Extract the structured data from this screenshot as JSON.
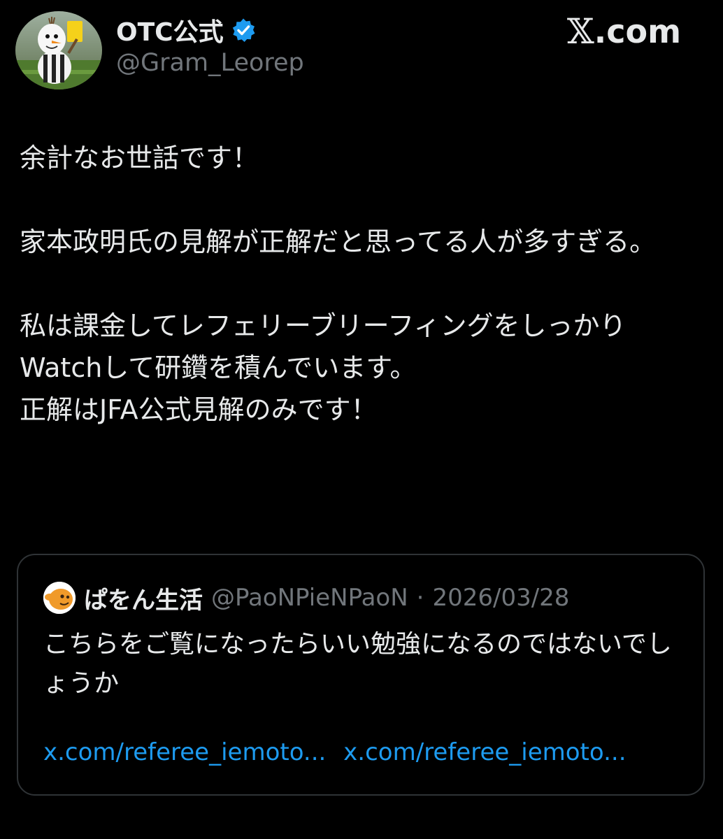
{
  "author": {
    "display_name": "OTC公式",
    "handle": "@Gram_Leorep",
    "verified": true,
    "avatar_icon": "snowman-referee-avatar"
  },
  "brand": {
    "site": ".com",
    "x_glyph": "𝕏"
  },
  "post": {
    "paragraphs": [
      "余計なお世話です！",
      "家本政明氏の見解が正解だと思ってる人が多すぎる。",
      "私は課金してレフェリーブリーフィングをしっかりWatchして研鑽を積んでいます。\n正解はJFA公式見解のみです！"
    ]
  },
  "quote": {
    "display_name": "ぱをん生活",
    "handle": "@PaoNPieNPaoN",
    "separator": "·",
    "date": "2026/03/28",
    "text": "こちらをご覧になったらいい勉強になるのではないでしょうか",
    "links": [
      "x.com/referee_iemoto...",
      "x.com/referee_iemoto..."
    ],
    "avatar_icon": "orange-creature-avatar"
  },
  "colors": {
    "background": "#000000",
    "text": "#e7e9ea",
    "muted": "#71767b",
    "link": "#1d9bf0",
    "verified_badge": "#1d9bf0",
    "border": "#2f3336"
  }
}
